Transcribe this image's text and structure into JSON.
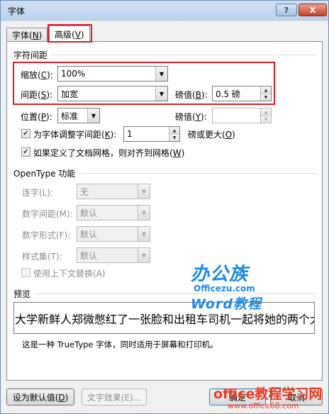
{
  "window": {
    "title": "字体",
    "help_glyph": "?",
    "close_glyph": "X"
  },
  "tabs": [
    {
      "label_pre": "字体(",
      "mnemonic": "N",
      "label_post": ")",
      "active": false
    },
    {
      "label_pre": "高级(",
      "mnemonic": "V",
      "label_post": ")",
      "active": true
    }
  ],
  "spacing": {
    "section_title": "字符间距",
    "scale": {
      "label_pre": "缩放(",
      "mnemonic": "C",
      "label_post": "):",
      "value": "100%"
    },
    "spacing": {
      "label_pre": "间距(",
      "mnemonic": "S",
      "label_post": "):",
      "value": "加宽"
    },
    "spacing_by": {
      "label_pre": "磅值(",
      "mnemonic": "B",
      "label_post": "):",
      "value": "0.5 磅"
    },
    "position": {
      "label_pre": "位置(",
      "mnemonic": "P",
      "label_post": "):",
      "value": "标准"
    },
    "position_by": {
      "label_pre": "磅值(",
      "mnemonic": "Y",
      "label_post": "):",
      "value": ""
    },
    "kerning": {
      "checked": true,
      "label_pre": "为字体调整字间距(",
      "mnemonic": "K",
      "label_post": "):",
      "value": "1",
      "suffix_pre": "磅或更大(",
      "suffix_mnemonic": "O",
      "suffix_post": ")"
    },
    "snap_grid": {
      "checked": true,
      "label_pre": "如果定义了文档网格，则对齐到网格(",
      "mnemonic": "W",
      "label_post": ")"
    }
  },
  "opentype": {
    "section_title": "OpenType 功能",
    "ligatures": {
      "label": "连字(L):",
      "value": "无"
    },
    "number_spacing": {
      "label": "数字间距(M):",
      "value": "默认"
    },
    "number_forms": {
      "label": "数字形式(F):",
      "value": "默认"
    },
    "stylistic_sets": {
      "label": "样式集(T):",
      "value": "默认"
    },
    "contextual": {
      "checked": false,
      "label": "使用上下文替换(A)"
    }
  },
  "preview": {
    "section_title": "预览",
    "sample_text": "大学新鲜人郑微憋红了一张脸和出租车司机一起将她的两个大",
    "description": "这是一种 TrueType 字体，同时适用于屏幕和打印机。"
  },
  "buttons": {
    "set_default_pre": "设为默认值(",
    "set_default_mnemonic": "D",
    "set_default_post": ")",
    "text_effects": "文字效果(E)...",
    "ok": "确定",
    "cancel": "取消"
  },
  "watermark": {
    "logo": "办公族",
    "site": "Officezu.com",
    "word": "Word教程",
    "bottom_title": "office教程学习网",
    "bottom_url": "www.office68.com"
  },
  "colors": {
    "highlight_border": "#d9202a",
    "watermark_blue": "#1f8ce0",
    "watermark_red": "#ee3a24"
  }
}
